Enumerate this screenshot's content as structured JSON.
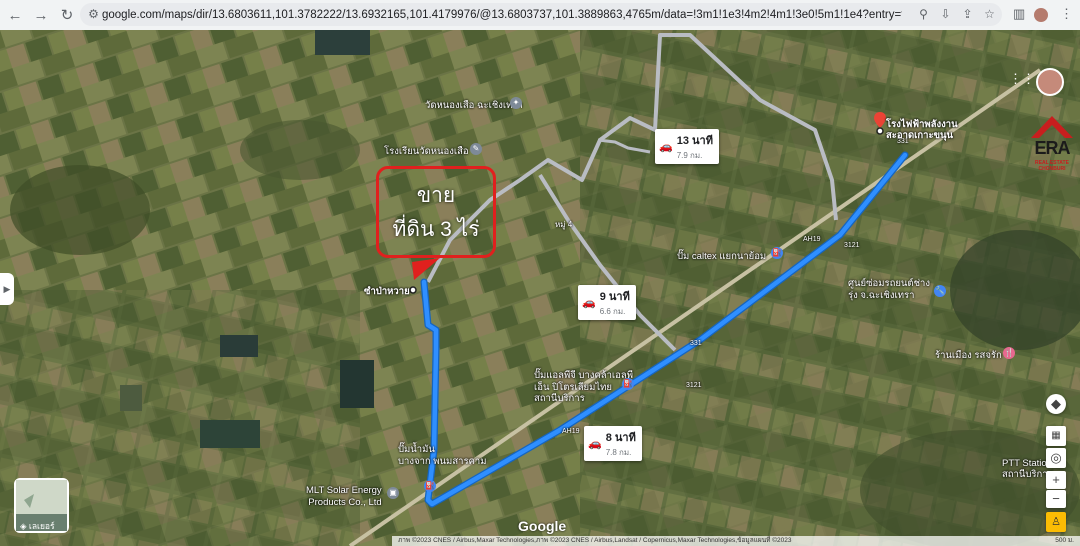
{
  "browser": {
    "url": "google.com/maps/dir/13.6803611,101.3782222/13.6932165,101.4179976/@13.6803737,101.3889863,4765m/data=!3m1!1e3!4m2!4m1!3e0!5m1!1e4?entry=ttu"
  },
  "overlay": {
    "sale_line1": "ขาย",
    "sale_line2": "ที่ดิน 3 ไร่"
  },
  "routes": [
    {
      "time": "13 นาที",
      "distance": "7.9 กม."
    },
    {
      "time": "9 นาที",
      "distance": "6.6 กม."
    },
    {
      "time": "8 นาที",
      "distance": "7.8 กม."
    }
  ],
  "places": {
    "wat": "วัดหนองเสือ ฉะเชิงเทรา",
    "school": "โรงเรียนวัดหนองเสือ",
    "origin": "ซำป่าหวาย",
    "destination_line1": "โรงไฟฟ้าพลังงาน",
    "destination_line2": "สะอาดเกาะขนุน",
    "caltex": "ปั๊ม caltex แยกนาย้อม",
    "service_center_line1": "ศูนย์ซ่อมรถยนต์ช่าง",
    "service_center_line2": "รุ่ง จ.ฉะเชิงเทรา",
    "restaurant": "ร้านเมือง รสจรัก",
    "gas_line1": "ปั๊มแอลพีจี บางคล้าเอลพี",
    "gas_line2": "เอ็น ปิโตรเลียมไทย",
    "gas_line3": "สถานีบริการ",
    "pump_line1": "ปั๊มน้ำมัน",
    "pump_line2": "บางจาก พนมสารคาม",
    "solar_line1": "MLT Solar Energy",
    "solar_line2": "Products Co., Ltd",
    "ptt_line1": "PTT Station",
    "ptt_line2": "สถานีบริการ",
    "road_label_1": "AH19",
    "road_label_2": "AH19",
    "shield_1": "331",
    "shield_2": "3121",
    "shield_3": "331",
    "shield_4": "3121",
    "village": "หมู่ 4"
  },
  "controls": {
    "layers_label": "เลเยอร์",
    "logo": "Google",
    "footer": "ภาพ ©2023 CNES / Airbus,Maxar Technologies,ภาพ ©2023 CNES / Airbus,Landsat / Copernicus,Maxar Technologies,ข้อมูลแผนที่ ©2023",
    "scale": "500 ม."
  },
  "brand": {
    "era_logo": "ERA",
    "era_sub": "REAL ESTATE CHONBURI"
  },
  "colors": {
    "route_main": "#2f8fff",
    "route_alt": "#b9bcc3",
    "sale_border": "#e0201e"
  }
}
